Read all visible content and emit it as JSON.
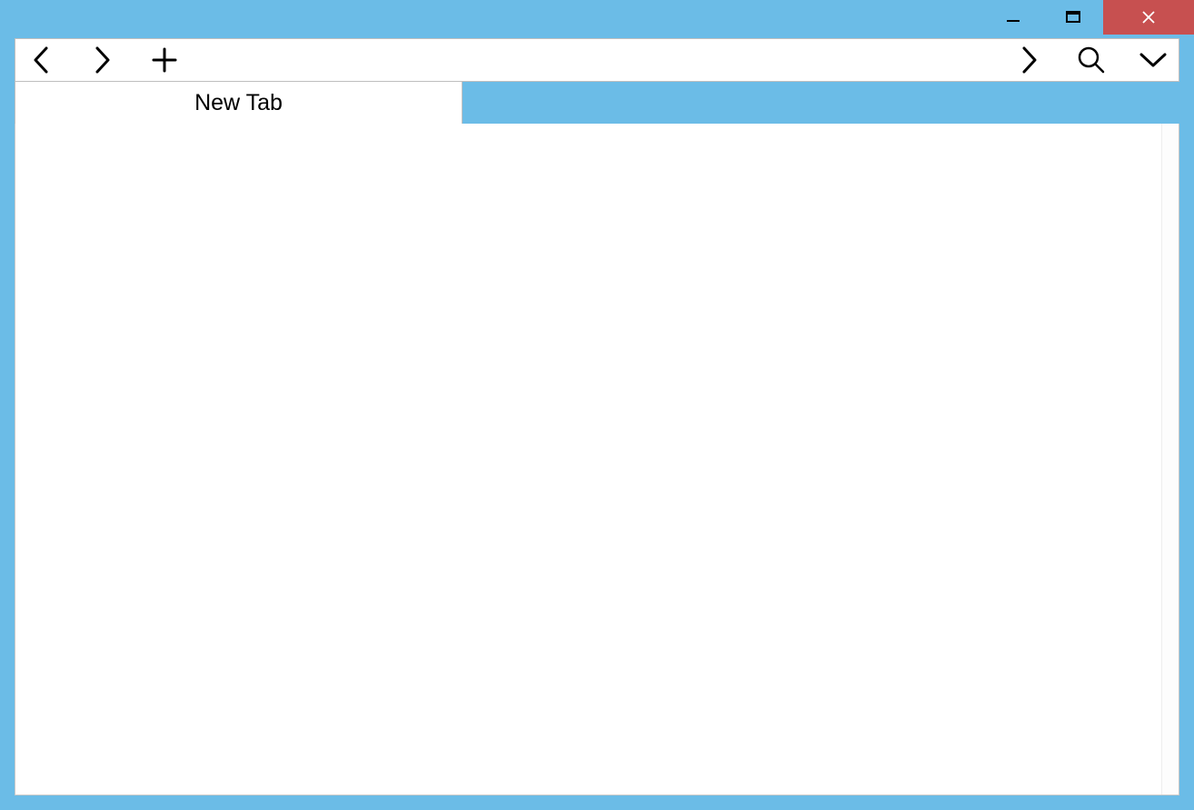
{
  "tabs": [
    {
      "label": "New Tab"
    }
  ]
}
